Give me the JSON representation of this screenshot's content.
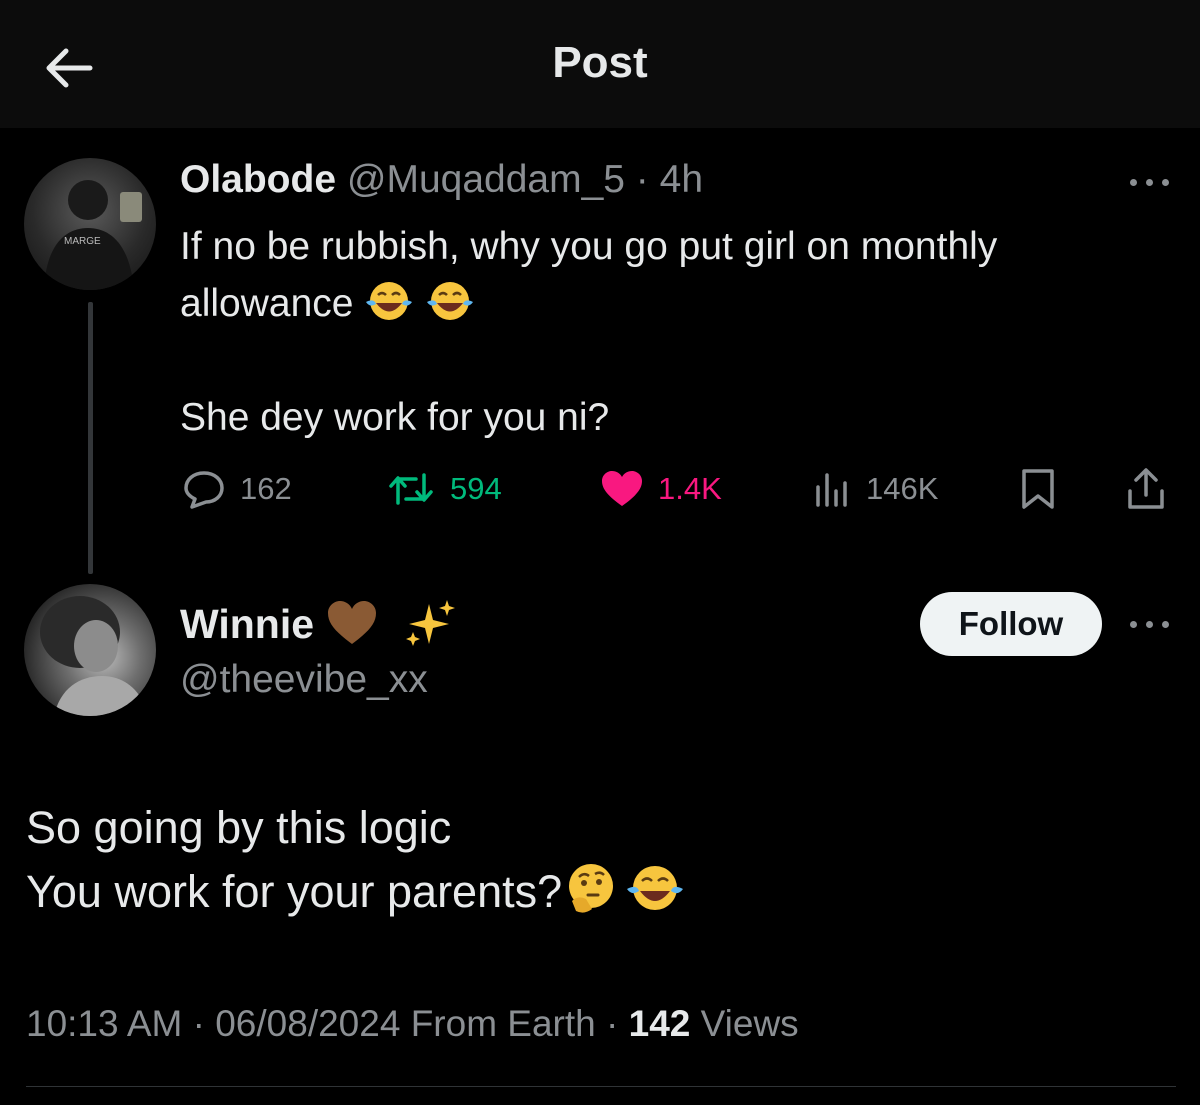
{
  "header": {
    "title": "Post"
  },
  "parent_post": {
    "display_name": "Olabode",
    "handle": "@Muqaddam_5",
    "time": "4h",
    "text_line1": "If no be rubbish, why you go put girl on monthly",
    "text_line2": "allowance",
    "text_line3": "She dey work for you ni?",
    "stats": {
      "replies": "162",
      "reposts": "594",
      "likes": "1.4K",
      "views": "146K"
    }
  },
  "reply_post": {
    "display_name": "Winnie",
    "handle": "@theevibe_xx",
    "follow_label": "Follow",
    "text_line1": "So going by this logic",
    "text_line2": "You work for your parents?",
    "timestamp": "10:13 AM",
    "date": "06/08/2024",
    "source": "From Earth",
    "views_count": "142",
    "views_label": "Views"
  },
  "colors": {
    "background": "#000000",
    "header_bg": "#0c0c0c",
    "repost_green": "#00ba7c",
    "like_pink": "#f91880",
    "muted": "#8b8f93"
  }
}
